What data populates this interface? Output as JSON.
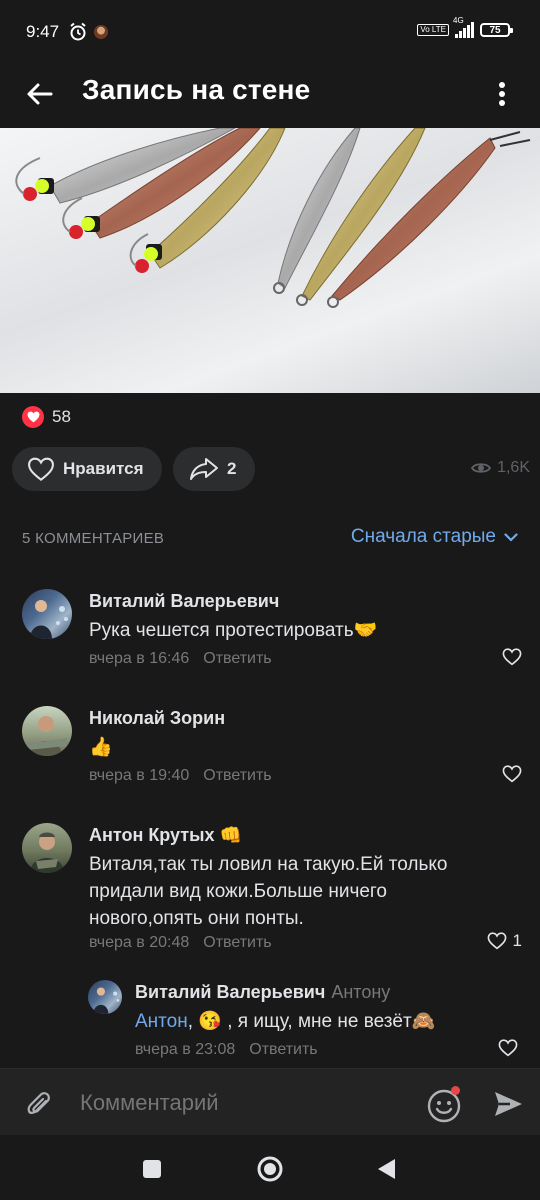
{
  "status_bar": {
    "time": "9:47",
    "network": "4G",
    "volte": "Vo LTE",
    "battery": "75"
  },
  "app_bar": {
    "title": "Запись на стене"
  },
  "post": {
    "likes_count": "58",
    "like_label": "Нравится",
    "share_count": "2",
    "views": "1,6K"
  },
  "comments": {
    "count_label": "5 КОММЕНТАРИЕВ",
    "sort_label": "Сначала старые",
    "reply_label": "Ответить",
    "items": [
      {
        "author": "Виталий Валерьевич",
        "text": "Рука чешется протестировать🤝",
        "time": "вчера в 16:46",
        "likes": ""
      },
      {
        "author": "Николай Зорин",
        "text": "👍",
        "time": "вчера в 19:40",
        "likes": ""
      },
      {
        "author": "Антон Крутых 👊",
        "text": "Виталя,так ты ловил на такую.Ей только придали вид кожи.Больше ничего нового,опять они понты.",
        "time": "вчера в 20:48",
        "likes": "1"
      },
      {
        "author": "Виталий Валерьевич",
        "reply_to": "Антону",
        "mention": "Антон",
        "text": ", 😘 , я ищу, мне не везёт🙈",
        "time": "вчера в 23:08",
        "likes": ""
      }
    ]
  },
  "composer": {
    "placeholder": "Комментарий"
  },
  "colors": {
    "background": "#19191a",
    "accent": "#71aaeb",
    "like": "#ff3347",
    "muted": "#76787a"
  }
}
